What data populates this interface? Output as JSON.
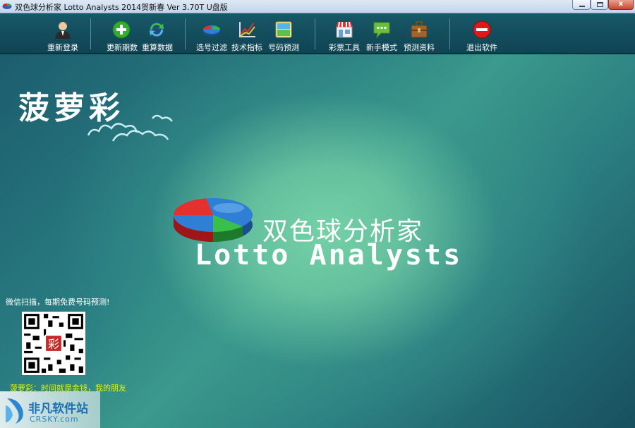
{
  "window": {
    "title": "双色球分析家 Lotto Analysts 2014贺新春 Ver 3.70T U盘版",
    "controls": {
      "minimize": "",
      "maximize": "",
      "close": "x"
    }
  },
  "toolbar": {
    "items": [
      {
        "label": "重新登录",
        "icon": "user-login-icon"
      },
      {
        "label": "更新期数",
        "icon": "add-icon"
      },
      {
        "label": "重算数据",
        "icon": "recalculate-icon"
      },
      {
        "label": "选号过滤",
        "icon": "pie-filter-icon"
      },
      {
        "label": "技术指标",
        "icon": "chart-indicator-icon"
      },
      {
        "label": "号码预测",
        "icon": "forecast-icon"
      },
      {
        "label": "彩票工具",
        "icon": "tools-shop-icon"
      },
      {
        "label": "新手模式",
        "icon": "chat-icon"
      },
      {
        "label": "预测资料",
        "icon": "briefcase-icon"
      },
      {
        "label": "退出软件",
        "icon": "exit-icon"
      }
    ]
  },
  "main": {
    "brand": "菠萝彩",
    "title_cn": "双色球分析家",
    "title_en": "Lotto Analysts",
    "scan_tip": "微信扫描，每期免费号码预测!",
    "qr_center": "彩",
    "slogan": "菠萝彩：时间就是金钱，我的朋友"
  },
  "watermark": {
    "cn": "非凡软件站",
    "en": "CRSKY.com"
  },
  "colors": {
    "toolbar": "#175868",
    "slogan": "#e9f300",
    "accent_green": "#74d0a5"
  }
}
